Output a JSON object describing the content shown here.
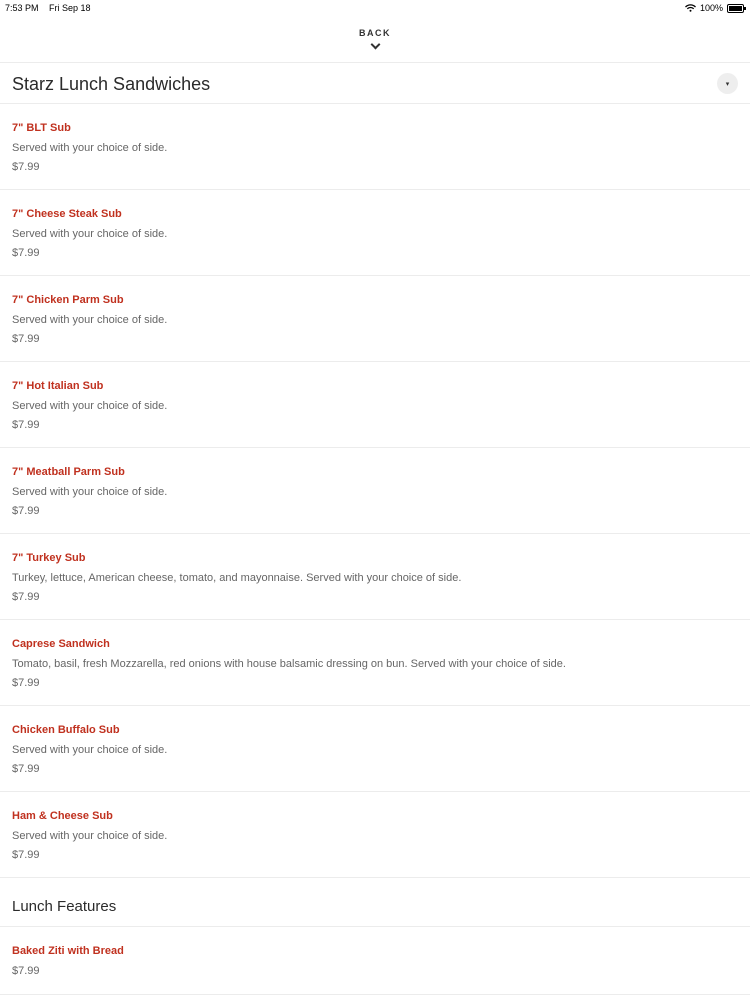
{
  "status_bar": {
    "time": "7:53 PM",
    "date": "Fri Sep 18",
    "battery_text": "100%",
    "battery_level": 1.0,
    "wifi_icon": "wifi-icon"
  },
  "nav": {
    "back_label": "BACK",
    "back_icon": "chevron-down-icon"
  },
  "section": {
    "title": "Starz Lunch Sandwiches",
    "collapse_icon": "▾",
    "items": [
      {
        "name": "7\" BLT Sub",
        "description": "Served with your choice of side.",
        "price": "$7.99"
      },
      {
        "name": "7\" Cheese Steak Sub",
        "description": "Served with your choice of side.",
        "price": "$7.99"
      },
      {
        "name": "7\" Chicken Parm Sub",
        "description": "Served with your choice of side.",
        "price": "$7.99"
      },
      {
        "name": "7\" Hot Italian Sub",
        "description": "Served with your choice of side.",
        "price": "$7.99"
      },
      {
        "name": "7\" Meatball Parm Sub",
        "description": "Served with your choice of side.",
        "price": "$7.99"
      },
      {
        "name": "7\" Turkey Sub",
        "description": "Turkey, lettuce, American cheese, tomato, and mayonnaise. Served with your choice of side.",
        "price": "$7.99"
      },
      {
        "name": "Caprese Sandwich",
        "description": "Tomato, basil, fresh Mozzarella, red onions with house balsamic dressing on bun. Served with your choice of side.",
        "price": "$7.99"
      },
      {
        "name": "Chicken Buffalo Sub",
        "description": "Served with your choice of side.",
        "price": "$7.99"
      },
      {
        "name": "Ham & Cheese Sub",
        "description": "Served with your choice of side.",
        "price": "$7.99"
      }
    ]
  },
  "section2": {
    "title": "Lunch Features",
    "items": [
      {
        "name": "Baked Ziti with Bread",
        "price": "$7.99"
      }
    ]
  },
  "colors": {
    "accent": "#c0311f",
    "muted_text": "#666666",
    "divider": "#ececec"
  }
}
